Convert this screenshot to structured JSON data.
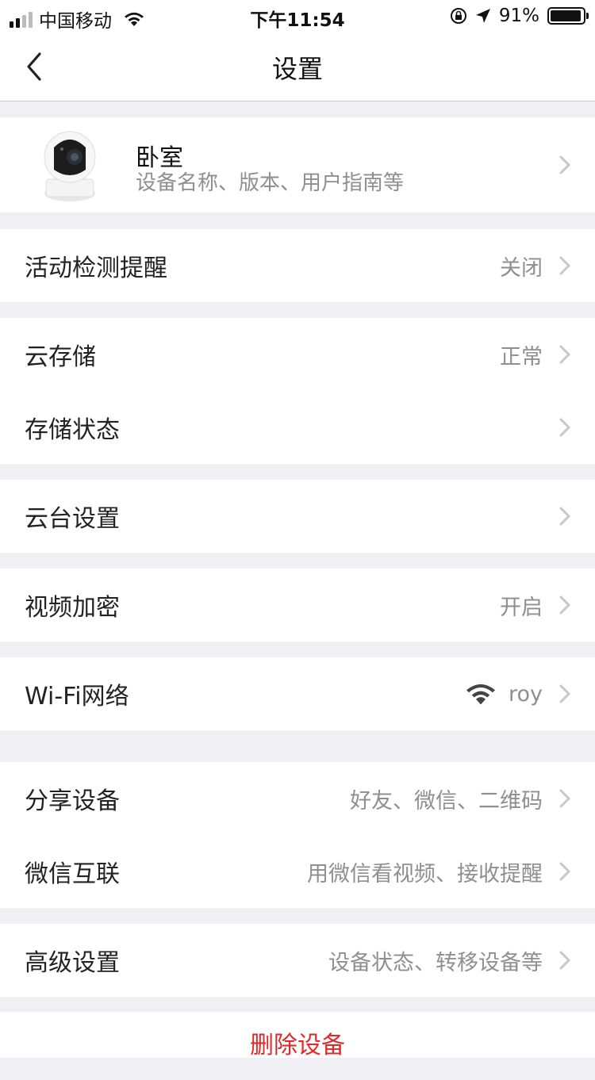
{
  "status_bar": {
    "carrier": "中国移动",
    "time": "下午11:54",
    "battery": "91%"
  },
  "nav": {
    "title": "设置"
  },
  "device": {
    "name": "卧室",
    "subtitle": "设备名称、版本、用户指南等"
  },
  "rows": {
    "motion": {
      "label": "活动检测提醒",
      "value": "关闭"
    },
    "cloud": {
      "label": "云存储",
      "value": "正常"
    },
    "storage": {
      "label": "存储状态",
      "value": ""
    },
    "ptz": {
      "label": "云台设置",
      "value": ""
    },
    "encrypt": {
      "label": "视频加密",
      "value": "开启"
    },
    "wifi": {
      "label": "Wi-Fi网络",
      "value": "roy"
    },
    "share": {
      "label": "分享设备",
      "value": "好友、微信、二维码"
    },
    "wechat": {
      "label": "微信互联",
      "value": "用微信看视频、接收提醒"
    },
    "advanced": {
      "label": "高级设置",
      "value": "设备状态、转移设备等"
    }
  },
  "delete_label": "删除设备",
  "colors": {
    "danger": "#e02a2a",
    "secondary_text": "#8e8e93",
    "background": "#efeff4"
  }
}
